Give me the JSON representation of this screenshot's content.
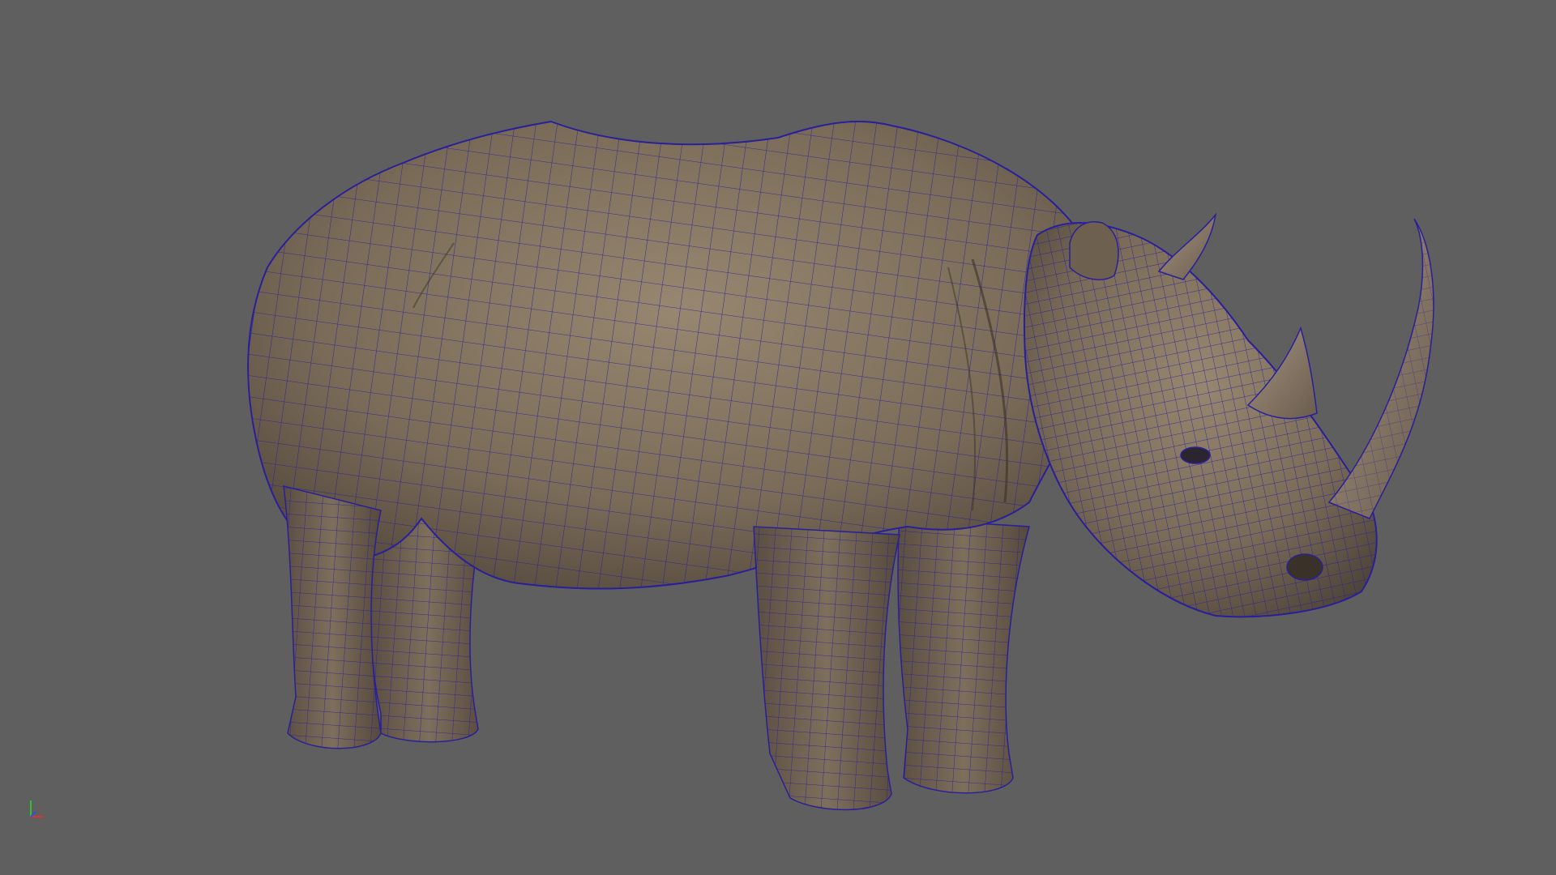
{
  "viewport": {
    "background_color": "#5f5f5f",
    "mesh_skin_color": "#7a6b58",
    "mesh_shadow_color": "#4a4036",
    "mesh_highlight_color": "#9a8a72",
    "wireframe_color": "#2a1f9a",
    "horn_color": "#8a7a66"
  },
  "axis_gizmo": {
    "icon": "axis-gizmo-icon",
    "x_color": "#e03030",
    "y_color": "#30c030",
    "z_color": "#3050e0"
  },
  "model": {
    "icon": "rhino-wireframe-model"
  }
}
